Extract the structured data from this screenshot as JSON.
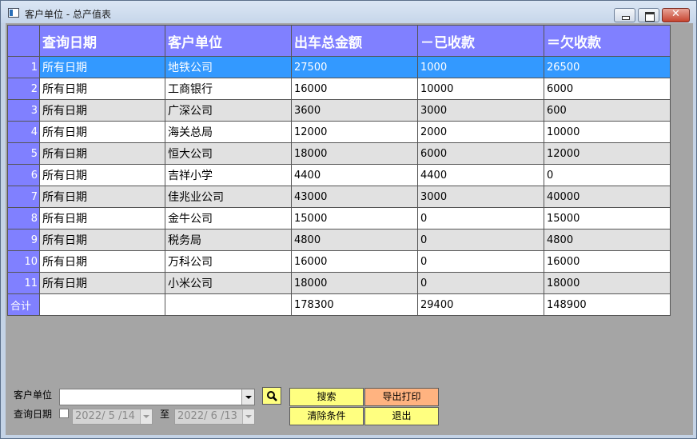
{
  "window": {
    "title": "客户单位 - 总产值表"
  },
  "grid": {
    "headers": [
      "",
      "查询日期",
      "客户单位",
      "出车总金额",
      "－已收款",
      "＝欠收款"
    ],
    "rows": [
      {
        "n": "1",
        "date": "所有日期",
        "client": "地铁公司",
        "total": "27500",
        "received": "1000",
        "owed": "26500"
      },
      {
        "n": "2",
        "date": "所有日期",
        "client": "工商银行",
        "total": "16000",
        "received": "10000",
        "owed": "6000"
      },
      {
        "n": "3",
        "date": "所有日期",
        "client": "广深公司",
        "total": "3600",
        "received": "3000",
        "owed": "600"
      },
      {
        "n": "4",
        "date": "所有日期",
        "client": "海关总局",
        "total": "12000",
        "received": "2000",
        "owed": "10000"
      },
      {
        "n": "5",
        "date": "所有日期",
        "client": "恒大公司",
        "total": "18000",
        "received": "6000",
        "owed": "12000"
      },
      {
        "n": "6",
        "date": "所有日期",
        "client": "吉祥小学",
        "total": "4400",
        "received": "4400",
        "owed": "0"
      },
      {
        "n": "7",
        "date": "所有日期",
        "client": "佳兆业公司",
        "total": "43000",
        "received": "3000",
        "owed": "40000"
      },
      {
        "n": "8",
        "date": "所有日期",
        "client": "金牛公司",
        "total": "15000",
        "received": "0",
        "owed": "15000"
      },
      {
        "n": "9",
        "date": "所有日期",
        "client": "税务局",
        "total": "4800",
        "received": "0",
        "owed": "4800"
      },
      {
        "n": "10",
        "date": "所有日期",
        "client": "万科公司",
        "total": "16000",
        "received": "0",
        "owed": "16000"
      },
      {
        "n": "11",
        "date": "所有日期",
        "client": "小米公司",
        "total": "18000",
        "received": "0",
        "owed": "18000"
      }
    ],
    "total": {
      "label": "合计",
      "total": "178300",
      "received": "29400",
      "owed": "148900"
    },
    "selected_row": 0
  },
  "filters": {
    "client_label": "客户单位",
    "client_value": "",
    "date_label": "查询日期",
    "date_from": "2022/ 5 /14",
    "to_label": "至",
    "date_to": "2022/ 6 /13"
  },
  "buttons": {
    "search": "搜索",
    "export": "导出打印",
    "clear": "清除条件",
    "exit": "退出"
  },
  "colors": {
    "header_bg": "#8080ff",
    "selected_row": "#3399ff",
    "alt_row": "#e1e1e1",
    "client_bg": "#a5a5a5",
    "yellow_button": "#ffff80",
    "orange_button": "#ffb380"
  },
  "icons": [
    "app-icon",
    "minimize-icon",
    "maximize-icon",
    "close-icon",
    "search-icon",
    "dropdown-arrow-icon"
  ]
}
